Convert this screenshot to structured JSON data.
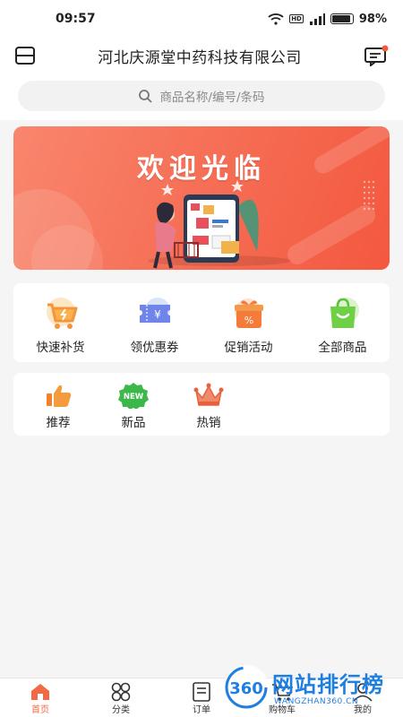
{
  "status_bar": {
    "time": "09:57",
    "network_badge": "HD",
    "battery": "98%"
  },
  "header": {
    "title": "河北庆源堂中药科技有限公司"
  },
  "search": {
    "placeholder": "商品名称/编号/条码"
  },
  "banner": {
    "headline": "欢迎光临"
  },
  "quick_entries": [
    {
      "label": "快速补货",
      "icon": "shopping-cart-icon"
    },
    {
      "label": "领优惠券",
      "icon": "coupon-icon"
    },
    {
      "label": "促销活动",
      "icon": "gift-box-icon"
    },
    {
      "label": "全部商品",
      "icon": "shopping-bag-icon"
    }
  ],
  "categories": [
    {
      "label": "推荐",
      "icon": "thumbs-up-icon"
    },
    {
      "label": "新品",
      "icon": "new-badge-icon",
      "badge": "NEW"
    },
    {
      "label": "热销",
      "icon": "crown-icon"
    }
  ],
  "tab_bar": [
    {
      "label": "首页",
      "icon": "home-icon",
      "active": true
    },
    {
      "label": "分类",
      "icon": "grid-icon",
      "active": false
    },
    {
      "label": "订单",
      "icon": "order-icon",
      "active": false
    },
    {
      "label": "购物车",
      "icon": "cart-icon",
      "active": false
    },
    {
      "label": "我的",
      "icon": "user-icon",
      "active": false
    }
  ],
  "watermark": {
    "logo": "360",
    "text": "网站排行榜",
    "sub": "WANGZHAN360.CN"
  },
  "colors": {
    "accent": "#f06a45",
    "banner": "#f56c53",
    "watermark": "#1f7fe0"
  }
}
